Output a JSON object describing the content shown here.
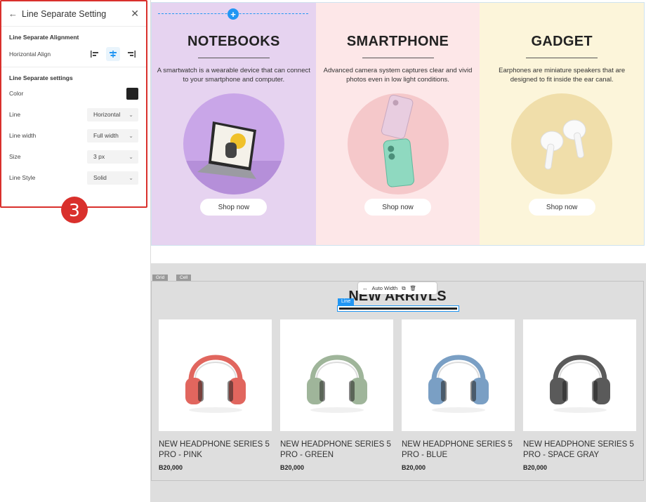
{
  "panel": {
    "title": "Line Separate Setting",
    "alignment_section": "Line Separate Alignment",
    "horizontal_align_label": "Horizontal Align",
    "settings_section": "Line Separate settings",
    "color_label": "Color",
    "color_value": "#222222",
    "line_label": "Line",
    "line_value": "Horizontal",
    "line_width_label": "Line width",
    "line_width_value": "Full width",
    "size_label": "Size",
    "size_value": "3 px",
    "line_style_label": "Line Style",
    "line_style_value": "Solid"
  },
  "step_badge": "3",
  "categories": [
    {
      "title": "NOTEBOOKS",
      "desc": "A smartwatch is a wearable device that can connect to your smartphone and computer.",
      "button": "Shop now",
      "bg": "#e6d3f0",
      "circle": "#c9a6e8"
    },
    {
      "title": "SMARTPHONE",
      "desc": "Advanced camera system captures clear and vivid photos even in low light conditions.",
      "button": "Shop now",
      "bg": "#fde7e8",
      "circle": "#f5c8ca"
    },
    {
      "title": "GADGET",
      "desc": "Earphones are miniature speakers that are designed to fit inside the ear canal.",
      "button": "Shop now",
      "bg": "#fcf5da",
      "circle": "#f0deaa"
    }
  ],
  "bottom": {
    "tag_grid": "Grid",
    "tag_cell": "Cell",
    "title": "NEW ARRIVLS",
    "toolbar_auto_width": "Auto Width",
    "line_tag": "Line"
  },
  "products": [
    {
      "name": "NEW HEADPHONE SERIES 5 PRO - PINK",
      "price": "B20,000",
      "color": "#e1665e"
    },
    {
      "name": "NEW HEADPHONE SERIES 5 PRO - GREEN",
      "price": "B20,000",
      "color": "#9fb59a"
    },
    {
      "name": "NEW HEADPHONE SERIES 5 PRO - BLUE",
      "price": "B20,000",
      "color": "#7a9fc4"
    },
    {
      "name": "NEW HEADPHONE SERIES 5 PRO - SPACE GRAY",
      "price": "B20,000",
      "color": "#5a5a5a"
    }
  ]
}
